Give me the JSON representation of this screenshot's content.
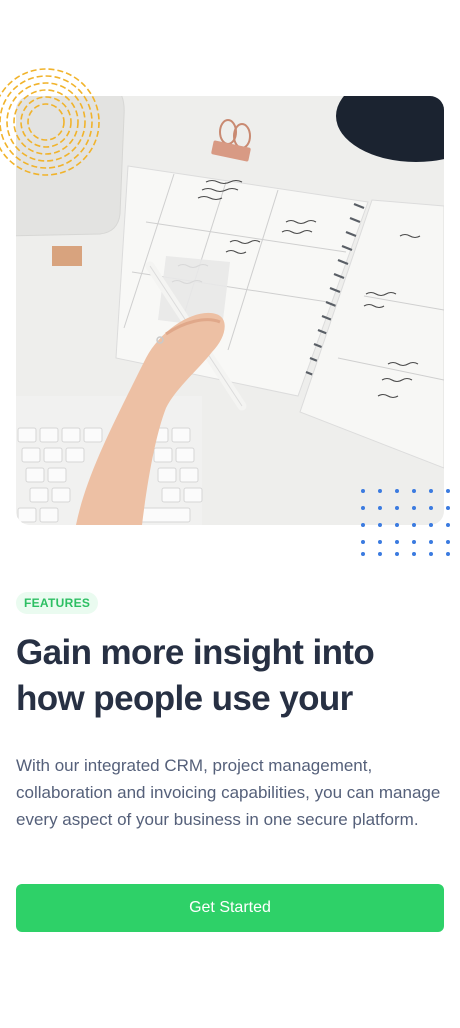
{
  "feature": {
    "badge": "FEATURES",
    "headline": "Gain more insight into how people use your",
    "body": "With our integrated CRM, project management, collaboration and invoicing capabilities, you can manage every aspect of your business in one secure platform.",
    "cta_label": "Get Started"
  },
  "colors": {
    "accent_green": "#2ed168",
    "badge_bg": "#eafbf0",
    "badge_text": "#2dbf63",
    "heading": "#273043",
    "body_text": "#55607a",
    "dots": "#3b7be0",
    "rings": "#f1b32b"
  },
  "icons": {
    "ring_decoration": "concentric-rings-decoration",
    "dot_decoration": "dot-grid-decoration"
  }
}
